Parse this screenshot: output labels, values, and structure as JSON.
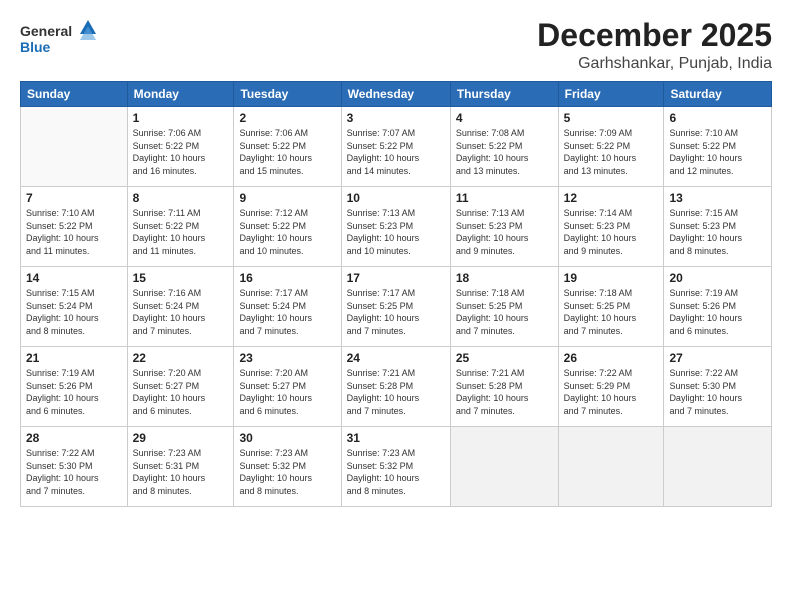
{
  "header": {
    "logo_line1": "General",
    "logo_line2": "Blue",
    "month": "December 2025",
    "location": "Garhshankar, Punjab, India"
  },
  "weekdays": [
    "Sunday",
    "Monday",
    "Tuesday",
    "Wednesday",
    "Thursday",
    "Friday",
    "Saturday"
  ],
  "weeks": [
    [
      {
        "day": "",
        "info": ""
      },
      {
        "day": "1",
        "info": "Sunrise: 7:06 AM\nSunset: 5:22 PM\nDaylight: 10 hours\nand 16 minutes."
      },
      {
        "day": "2",
        "info": "Sunrise: 7:06 AM\nSunset: 5:22 PM\nDaylight: 10 hours\nand 15 minutes."
      },
      {
        "day": "3",
        "info": "Sunrise: 7:07 AM\nSunset: 5:22 PM\nDaylight: 10 hours\nand 14 minutes."
      },
      {
        "day": "4",
        "info": "Sunrise: 7:08 AM\nSunset: 5:22 PM\nDaylight: 10 hours\nand 13 minutes."
      },
      {
        "day": "5",
        "info": "Sunrise: 7:09 AM\nSunset: 5:22 PM\nDaylight: 10 hours\nand 13 minutes."
      },
      {
        "day": "6",
        "info": "Sunrise: 7:10 AM\nSunset: 5:22 PM\nDaylight: 10 hours\nand 12 minutes."
      }
    ],
    [
      {
        "day": "7",
        "info": "Sunrise: 7:10 AM\nSunset: 5:22 PM\nDaylight: 10 hours\nand 11 minutes."
      },
      {
        "day": "8",
        "info": "Sunrise: 7:11 AM\nSunset: 5:22 PM\nDaylight: 10 hours\nand 11 minutes."
      },
      {
        "day": "9",
        "info": "Sunrise: 7:12 AM\nSunset: 5:22 PM\nDaylight: 10 hours\nand 10 minutes."
      },
      {
        "day": "10",
        "info": "Sunrise: 7:13 AM\nSunset: 5:23 PM\nDaylight: 10 hours\nand 10 minutes."
      },
      {
        "day": "11",
        "info": "Sunrise: 7:13 AM\nSunset: 5:23 PM\nDaylight: 10 hours\nand 9 minutes."
      },
      {
        "day": "12",
        "info": "Sunrise: 7:14 AM\nSunset: 5:23 PM\nDaylight: 10 hours\nand 9 minutes."
      },
      {
        "day": "13",
        "info": "Sunrise: 7:15 AM\nSunset: 5:23 PM\nDaylight: 10 hours\nand 8 minutes."
      }
    ],
    [
      {
        "day": "14",
        "info": "Sunrise: 7:15 AM\nSunset: 5:24 PM\nDaylight: 10 hours\nand 8 minutes."
      },
      {
        "day": "15",
        "info": "Sunrise: 7:16 AM\nSunset: 5:24 PM\nDaylight: 10 hours\nand 7 minutes."
      },
      {
        "day": "16",
        "info": "Sunrise: 7:17 AM\nSunset: 5:24 PM\nDaylight: 10 hours\nand 7 minutes."
      },
      {
        "day": "17",
        "info": "Sunrise: 7:17 AM\nSunset: 5:25 PM\nDaylight: 10 hours\nand 7 minutes."
      },
      {
        "day": "18",
        "info": "Sunrise: 7:18 AM\nSunset: 5:25 PM\nDaylight: 10 hours\nand 7 minutes."
      },
      {
        "day": "19",
        "info": "Sunrise: 7:18 AM\nSunset: 5:25 PM\nDaylight: 10 hours\nand 7 minutes."
      },
      {
        "day": "20",
        "info": "Sunrise: 7:19 AM\nSunset: 5:26 PM\nDaylight: 10 hours\nand 6 minutes."
      }
    ],
    [
      {
        "day": "21",
        "info": "Sunrise: 7:19 AM\nSunset: 5:26 PM\nDaylight: 10 hours\nand 6 minutes."
      },
      {
        "day": "22",
        "info": "Sunrise: 7:20 AM\nSunset: 5:27 PM\nDaylight: 10 hours\nand 6 minutes."
      },
      {
        "day": "23",
        "info": "Sunrise: 7:20 AM\nSunset: 5:27 PM\nDaylight: 10 hours\nand 6 minutes."
      },
      {
        "day": "24",
        "info": "Sunrise: 7:21 AM\nSunset: 5:28 PM\nDaylight: 10 hours\nand 7 minutes."
      },
      {
        "day": "25",
        "info": "Sunrise: 7:21 AM\nSunset: 5:28 PM\nDaylight: 10 hours\nand 7 minutes."
      },
      {
        "day": "26",
        "info": "Sunrise: 7:22 AM\nSunset: 5:29 PM\nDaylight: 10 hours\nand 7 minutes."
      },
      {
        "day": "27",
        "info": "Sunrise: 7:22 AM\nSunset: 5:30 PM\nDaylight: 10 hours\nand 7 minutes."
      }
    ],
    [
      {
        "day": "28",
        "info": "Sunrise: 7:22 AM\nSunset: 5:30 PM\nDaylight: 10 hours\nand 7 minutes."
      },
      {
        "day": "29",
        "info": "Sunrise: 7:23 AM\nSunset: 5:31 PM\nDaylight: 10 hours\nand 8 minutes."
      },
      {
        "day": "30",
        "info": "Sunrise: 7:23 AM\nSunset: 5:32 PM\nDaylight: 10 hours\nand 8 minutes."
      },
      {
        "day": "31",
        "info": "Sunrise: 7:23 AM\nSunset: 5:32 PM\nDaylight: 10 hours\nand 8 minutes."
      },
      {
        "day": "",
        "info": ""
      },
      {
        "day": "",
        "info": ""
      },
      {
        "day": "",
        "info": ""
      }
    ]
  ]
}
